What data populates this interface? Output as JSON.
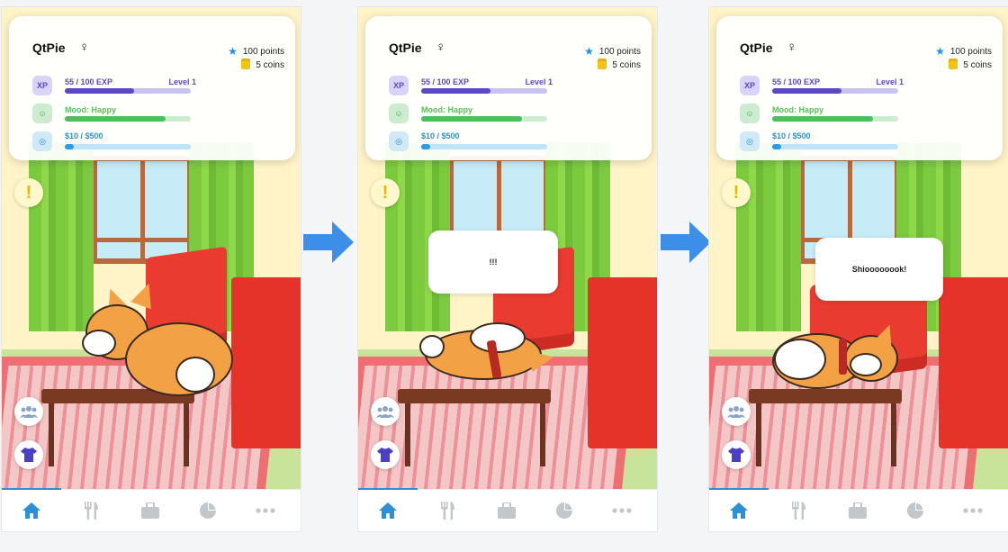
{
  "screens": [
    {
      "pet_name": "QtPie",
      "points": "100 points",
      "coins": "5 coins",
      "xp_badge": "XP",
      "xp_text": "55 / 100 EXP",
      "level_text": "Level 1",
      "xp_progress": 0.55,
      "mood_text": "Mood: Happy",
      "mood_progress": 0.8,
      "money_text": "$10 / $500",
      "money_progress": 0.07,
      "speech": ""
    },
    {
      "pet_name": "QtPie",
      "points": "100 points",
      "coins": "5 coins",
      "xp_badge": "XP",
      "xp_text": "55 / 100 EXP",
      "level_text": "Level 1",
      "xp_progress": 0.55,
      "mood_text": "Mood: Happy",
      "mood_progress": 0.8,
      "money_text": "$10 / $500",
      "money_progress": 0.07,
      "speech": "!!!"
    },
    {
      "pet_name": "QtPie",
      "points": "100 points",
      "coins": "5 coins",
      "xp_badge": "XP",
      "xp_text": "55 / 100 EXP",
      "level_text": "Level 1",
      "xp_progress": 0.55,
      "mood_text": "Mood: Happy",
      "mood_progress": 0.8,
      "money_text": "$10 / $500",
      "money_progress": 0.07,
      "speech": "Shioooooook!"
    }
  ],
  "alert_symbol": "!",
  "icons": {
    "gender": "female-icon",
    "points": "star-icon",
    "coins": "coin-stack-icon",
    "mood": "smiley-icon",
    "money": "target-icon",
    "friends": "people-icon",
    "wardrobe": "shirt-icon",
    "tabs": [
      "home-icon",
      "food-icon",
      "bag-icon",
      "pie-chart-icon",
      "more-icon"
    ]
  },
  "colors": {
    "xp": "#5b48c9",
    "mood": "#4cbe5c",
    "money": "#2d9be3",
    "arrow": "#3d8ee8",
    "active_tab": "#2d8fd6",
    "inactive_tab": "#c2c7cc"
  }
}
